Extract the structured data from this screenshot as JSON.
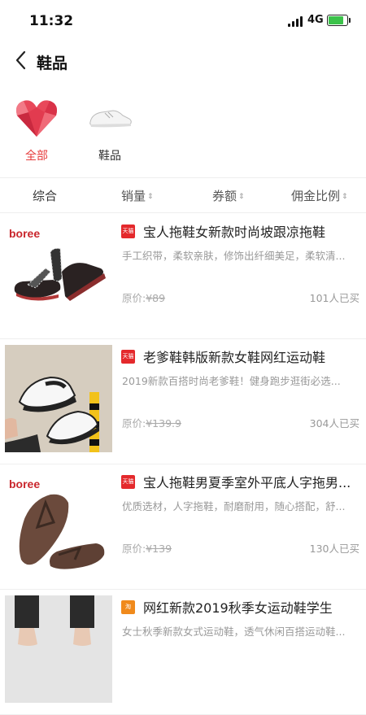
{
  "status_bar": {
    "time": "11:32",
    "network": "4G"
  },
  "header": {
    "title": "鞋品"
  },
  "categories": [
    {
      "label": "全部",
      "selected": true,
      "icon": "heart-icon"
    },
    {
      "label": "鞋品",
      "selected": false,
      "icon": "sneaker-icon"
    }
  ],
  "sort_bar": {
    "items": [
      {
        "label": "综合",
        "arrow": ""
      },
      {
        "label": "销量",
        "arrow": "⇕"
      },
      {
        "label": "券额",
        "arrow": "⇕"
      },
      {
        "label": "佣金比例",
        "arrow": "⇕"
      }
    ]
  },
  "colors": {
    "accent": "#e63b3b",
    "tmall_badge": "#e4292c",
    "taobao_badge": "#f08a1c"
  },
  "products": [
    {
      "brand": "boree",
      "badge": "天猫",
      "title": "宝人拖鞋女新款时尚坡跟凉拖鞋",
      "desc": "手工织带，柔软亲肤，修饰出纤细美足，柔软清...",
      "price_label": "原价:",
      "price": "¥89",
      "sold": "101人已买"
    },
    {
      "brand": "",
      "badge": "天猫",
      "title": "老爹鞋韩版新款女鞋网红运动鞋",
      "desc": "2019新款百搭时尚老爹鞋！健身跑步逛街必选...",
      "price_label": "原价:",
      "price": "¥139.9",
      "sold": "304人已买"
    },
    {
      "brand": "boree",
      "badge": "天猫",
      "title": "宝人拖鞋男夏季室外平底人字拖男...",
      "desc": "优质选材，人字拖鞋，耐磨耐用，随心搭配，舒...",
      "price_label": "原价:",
      "price": "¥139",
      "sold": "130人已买"
    },
    {
      "brand": "",
      "badge": "淘",
      "title": "网红新款2019秋季女运动鞋学生",
      "desc": "女士秋季新款女式运动鞋，透气休闲百搭运动鞋...",
      "price_label": "",
      "price": "",
      "sold": ""
    }
  ]
}
